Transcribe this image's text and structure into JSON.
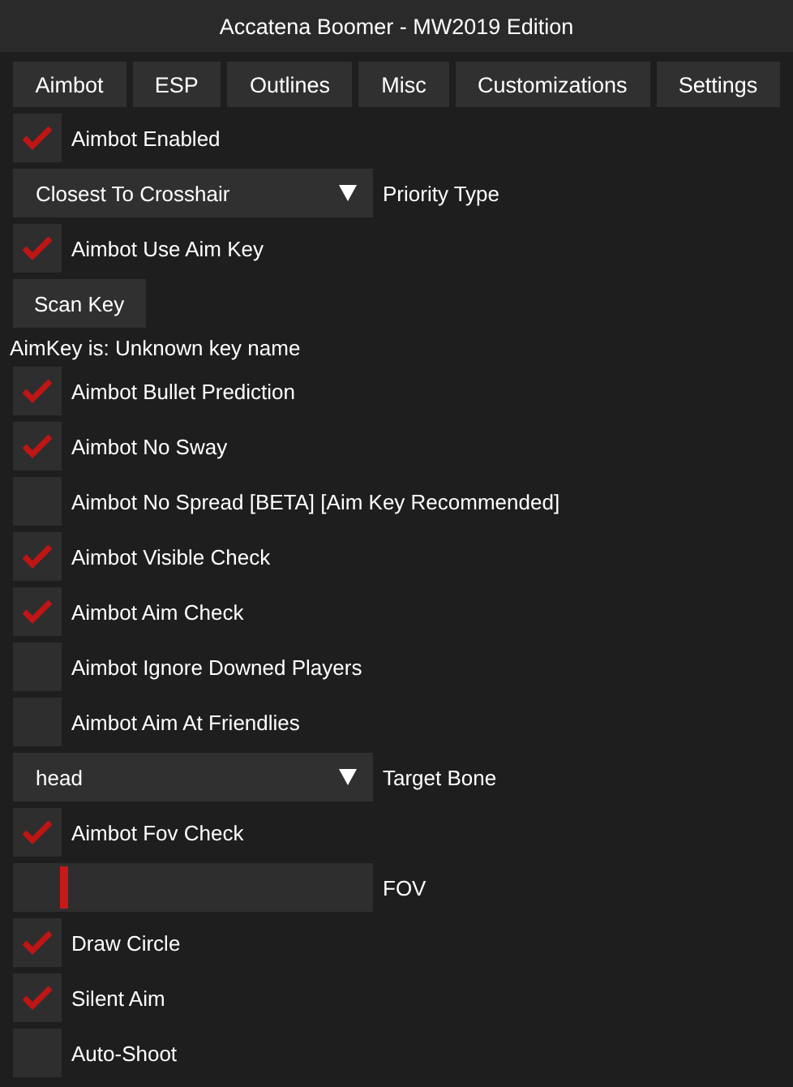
{
  "window": {
    "title": "Accatena Boomer - MW2019 Edition"
  },
  "tabs": [
    {
      "label": "Aimbot"
    },
    {
      "label": "ESP"
    },
    {
      "label": "Outlines"
    },
    {
      "label": "Misc"
    },
    {
      "label": "Customizations"
    },
    {
      "label": "Settings"
    }
  ],
  "items": [
    {
      "kind": "checkbox",
      "label": "Aimbot Enabled",
      "checked": true
    },
    {
      "kind": "dropdown",
      "value": "Closest To Crosshair",
      "caption": "Priority Type"
    },
    {
      "kind": "checkbox",
      "label": "Aimbot Use Aim Key",
      "checked": true
    },
    {
      "kind": "button",
      "label": "Scan Key"
    },
    {
      "kind": "text",
      "label": "AimKey is: Unknown key name"
    },
    {
      "kind": "checkbox",
      "label": "Aimbot Bullet Prediction",
      "checked": true
    },
    {
      "kind": "checkbox",
      "label": "Aimbot No Sway",
      "checked": true
    },
    {
      "kind": "checkbox",
      "label": "Aimbot No Spread [BETA] [Aim Key Recommended]",
      "checked": false
    },
    {
      "kind": "checkbox",
      "label": "Aimbot Visible Check",
      "checked": true
    },
    {
      "kind": "checkbox",
      "label": "Aimbot Aim Check",
      "checked": true
    },
    {
      "kind": "checkbox",
      "label": "Aimbot Ignore Downed Players",
      "checked": false
    },
    {
      "kind": "checkbox",
      "label": "Aimbot Aim At Friendlies",
      "checked": false
    },
    {
      "kind": "dropdown",
      "value": "head",
      "caption": "Target Bone"
    },
    {
      "kind": "checkbox",
      "label": "Aimbot Fov Check",
      "checked": true
    },
    {
      "kind": "slider",
      "label": "FOV",
      "level": 0.13
    },
    {
      "kind": "checkbox",
      "label": "Draw Circle",
      "checked": true
    },
    {
      "kind": "checkbox",
      "label": "Silent Aim",
      "checked": true
    },
    {
      "kind": "checkbox",
      "label": "Auto-Shoot",
      "checked": false
    }
  ]
}
